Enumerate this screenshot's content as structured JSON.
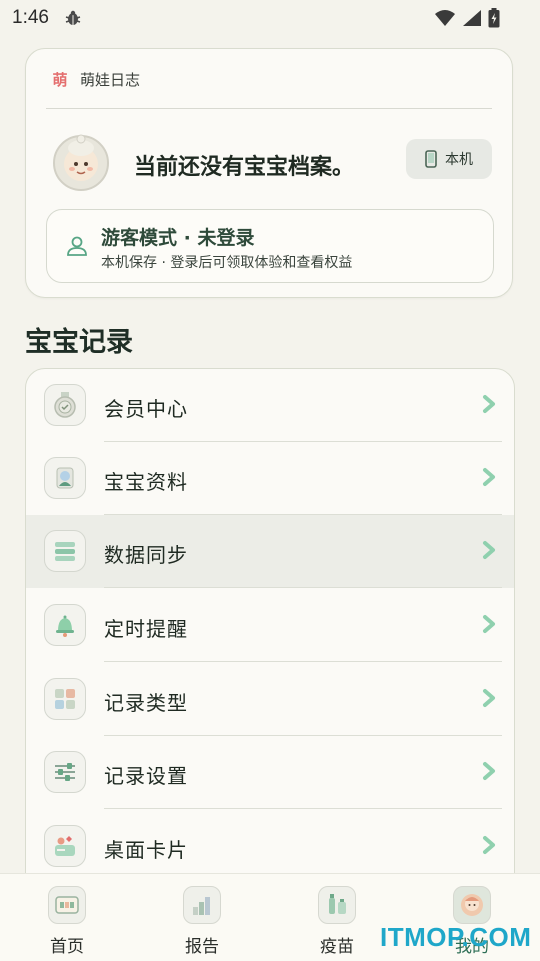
{
  "status_bar": {
    "time": "1:46"
  },
  "profile": {
    "app_name": "萌娃日志",
    "logo_char": "萌",
    "no_profile_text": "当前还没有宝宝档案。",
    "local_button": "本机",
    "guest_title": "游客模式 · 未登录",
    "guest_subtitle": "本机保存 · 登录后可领取体验和查看权益"
  },
  "section_title": "宝宝记录",
  "menu": {
    "items": [
      {
        "label": "会员中心",
        "icon": "medal-icon"
      },
      {
        "label": "宝宝资料",
        "icon": "baby-profile-icon"
      },
      {
        "label": "数据同步",
        "icon": "sync-list-icon"
      },
      {
        "label": "定时提醒",
        "icon": "bell-icon"
      },
      {
        "label": "记录类型",
        "icon": "category-grid-icon"
      },
      {
        "label": "记录设置",
        "icon": "sliders-icon"
      },
      {
        "label": "桌面卡片",
        "icon": "widget-card-icon"
      }
    ],
    "active_index": 2
  },
  "bottom_nav": {
    "items": [
      {
        "label": "首页",
        "icon": "home-icon"
      },
      {
        "label": "报告",
        "icon": "report-icon"
      },
      {
        "label": "疫苗",
        "icon": "vaccine-icon"
      },
      {
        "label": "我的",
        "icon": "profile-icon"
      }
    ],
    "active_index": 3
  },
  "watermark": "ITMOP.COM",
  "colors": {
    "background": "#f4f3ec",
    "card": "#fbfaf6",
    "accent_green": "#2d6e55",
    "chevron": "#8fd0ae",
    "watermark": "#1fa7c9"
  }
}
